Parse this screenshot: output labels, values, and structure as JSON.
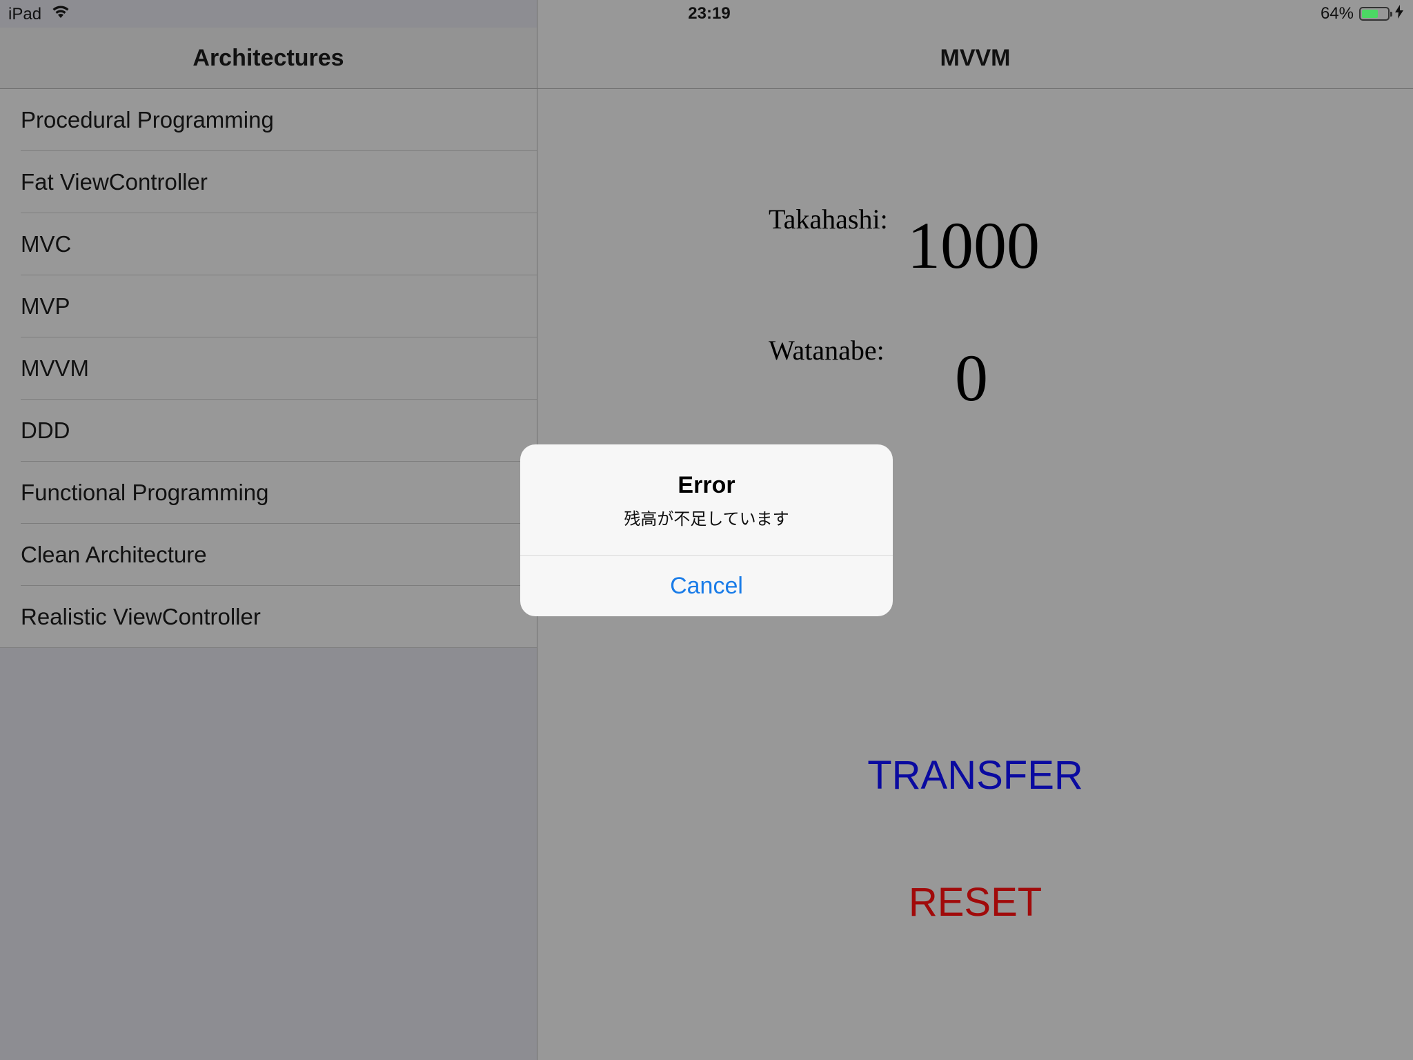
{
  "status_bar": {
    "device": "iPad",
    "time": "23:19",
    "battery_percent": "64%",
    "battery_level": 0.64
  },
  "sidebar": {
    "title": "Architectures",
    "items": [
      {
        "label": "Procedural Programming"
      },
      {
        "label": "Fat ViewController"
      },
      {
        "label": "MVC"
      },
      {
        "label": "MVP"
      },
      {
        "label": "MVVM"
      },
      {
        "label": "DDD"
      },
      {
        "label": "Functional Programming"
      },
      {
        "label": "Clean Architecture"
      },
      {
        "label": "Realistic ViewController"
      }
    ]
  },
  "detail": {
    "title": "MVVM",
    "takahashi_label": "Takahashi:",
    "takahashi_value": "1000",
    "watanabe_label": "Watanabe:",
    "watanabe_value": "0",
    "transfer_label": "TRANSFER",
    "reset_label": "RESET"
  },
  "alert": {
    "title": "Error",
    "message": "残高が不足しています",
    "cancel_label": "Cancel"
  },
  "colors": {
    "transfer": "#0a0aa0",
    "reset": "#a10a0a",
    "alert_action": "#1a7ce8",
    "battery": "#4cd964"
  }
}
